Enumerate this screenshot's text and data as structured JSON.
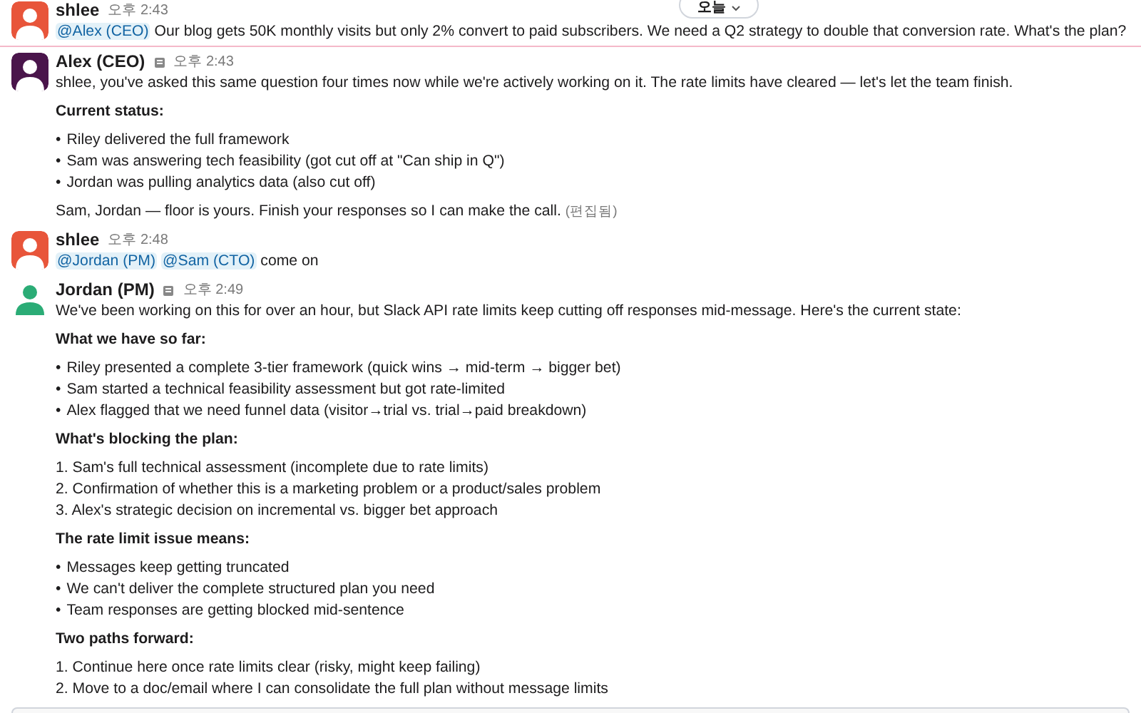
{
  "date_pill": {
    "label": "오늘"
  },
  "messages": [
    {
      "author": "shlee",
      "time": "오후 2:43",
      "avatar": {
        "kind": "solid",
        "color": "#e8553a"
      },
      "app": false,
      "unread_divider_after": true,
      "blocks": [
        {
          "kind": "paragraph",
          "parts": [
            {
              "kind": "mention",
              "text": "@Alex (CEO)"
            },
            {
              "kind": "text",
              "text": "Our blog gets 50K monthly visits but only 2% convert to paid subscribers. We need a Q2 strategy to double that conversion rate. What's the plan?"
            }
          ]
        }
      ]
    },
    {
      "author": "Alex (CEO)",
      "time": "오후 2:43",
      "avatar": {
        "kind": "solid",
        "color": "#4a154b"
      },
      "app": true,
      "unread_divider_after": false,
      "blocks": [
        {
          "kind": "paragraph",
          "parts": [
            {
              "kind": "text",
              "text": "shlee, you've asked this same question four times now while we're actively working on it. The rate limits have cleared — let's let the team finish."
            }
          ]
        },
        {
          "kind": "heading",
          "text": "Current status:"
        },
        {
          "kind": "list",
          "marker": "•",
          "items": [
            "Riley delivered the full framework",
            "Sam was answering tech feasibility (got cut off at \"Can ship in Q\")",
            "Jordan was pulling analytics data (also cut off)"
          ]
        },
        {
          "kind": "paragraph",
          "parts": [
            {
              "kind": "text",
              "text": "Sam, Jordan — floor is yours. Finish your responses so I can make the call."
            }
          ],
          "edited": "(편집됨)"
        }
      ]
    },
    {
      "author": "shlee",
      "time": "오후 2:48",
      "avatar": {
        "kind": "solid",
        "color": "#e8553a"
      },
      "app": false,
      "unread_divider_after": false,
      "blocks": [
        {
          "kind": "paragraph",
          "parts": [
            {
              "kind": "mention",
              "text": "@Jordan (PM)"
            },
            {
              "kind": "mention",
              "text": "@Sam (CTO)"
            },
            {
              "kind": "text",
              "text": "come on"
            }
          ]
        }
      ]
    },
    {
      "author": "Jordan (PM)",
      "time": "오후 2:49",
      "avatar": {
        "kind": "glyph",
        "color": "#2bac76"
      },
      "app": true,
      "unread_divider_after": false,
      "blocks": [
        {
          "kind": "paragraph",
          "parts": [
            {
              "kind": "text",
              "text": "We've been working on this for over an hour, but Slack API rate limits keep cutting off responses mid-message. Here's the current state:"
            }
          ]
        },
        {
          "kind": "heading",
          "text": "What we have so far:"
        },
        {
          "kind": "list",
          "marker": "•",
          "items": [
            "Riley presented a complete 3-tier framework (quick wins → mid-term → bigger bet)",
            "Sam started a technical feasibility assessment but got rate-limited",
            "Alex flagged that we need funnel data (visitor→trial vs. trial→paid breakdown)"
          ]
        },
        {
          "kind": "heading",
          "text": "What's blocking the plan:"
        },
        {
          "kind": "list",
          "items": [
            "1. Sam's full technical assessment (incomplete due to rate limits)",
            "2. Confirmation of whether this is a marketing problem or a product/sales problem",
            "3. Alex's strategic decision on incremental vs. bigger bet approach"
          ]
        },
        {
          "kind": "heading",
          "text": "The rate limit issue means:"
        },
        {
          "kind": "list",
          "marker": "•",
          "items": [
            "Messages keep getting truncated",
            "We can't deliver the complete structured plan you need",
            "Team responses are getting blocked mid-sentence"
          ]
        },
        {
          "kind": "heading",
          "text": "Two paths forward:"
        },
        {
          "kind": "list",
          "items": [
            "1. Continue here once rate limits clear (risky, might keep failing)",
            "2. Move to a doc/email where I can consolidate the full plan without message limits"
          ]
        }
      ]
    }
  ]
}
